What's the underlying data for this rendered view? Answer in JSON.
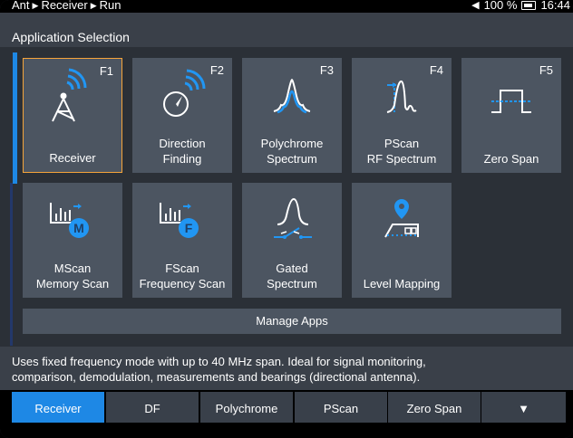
{
  "status": {
    "path": [
      "Ant",
      "Receiver",
      "Run"
    ],
    "volume_icon": "speaker-icon",
    "battery": "100 %",
    "time": "16:44"
  },
  "title": "Application Selection",
  "tiles": [
    {
      "key": "F1",
      "label": "Receiver",
      "icon": "antenna-wifi-icon",
      "selected": true
    },
    {
      "key": "F2",
      "label": "Direction\nFinding",
      "icon": "compass-wifi-icon"
    },
    {
      "key": "F3",
      "label": "Polychrome\nSpectrum",
      "icon": "polychrome-spectrum-icon"
    },
    {
      "key": "F4",
      "label": "PScan\nRF Spectrum",
      "icon": "pscan-spectrum-icon"
    },
    {
      "key": "F5",
      "label": "Zero Span",
      "icon": "zero-span-pulse-icon"
    },
    {
      "key": "",
      "label": "MScan\nMemory Scan",
      "icon": "mscan-icon"
    },
    {
      "key": "",
      "label": "FScan\nFrequency Scan",
      "icon": "fscan-icon"
    },
    {
      "key": "",
      "label": "Gated\nSpectrum",
      "icon": "gated-spectrum-icon"
    },
    {
      "key": "",
      "label": "Level Mapping",
      "icon": "level-mapping-icon"
    }
  ],
  "manage_apps": "Manage Apps",
  "description_line1": "Uses fixed frequency mode with up to 40 MHz span. Ideal for signal monitoring,",
  "description_line2": "comparison, demodulation, measurements and bearings (directional antenna).",
  "softkeys": [
    "Receiver",
    "DF",
    "Polychrome",
    "PScan",
    "Zero Span"
  ],
  "softkey_more": "▼",
  "colors": {
    "accent": "#1e88e5",
    "selected_border": "#f5a43a",
    "tile": "#4c5561"
  }
}
